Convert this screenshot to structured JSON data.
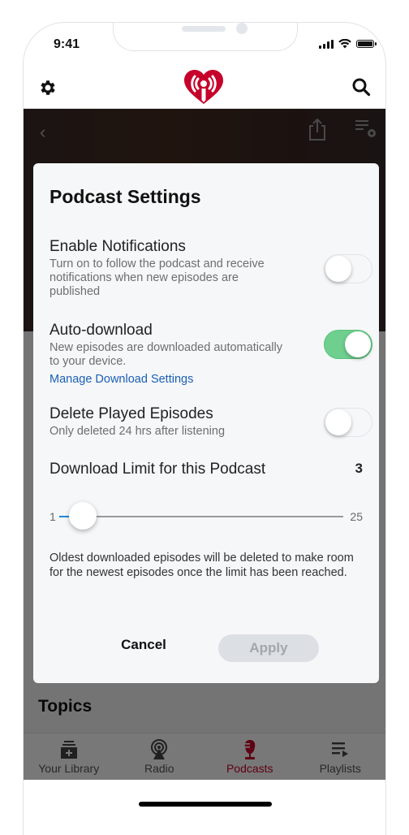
{
  "status_bar": {
    "time": "9:41"
  },
  "app_bar": {
    "logo": "iheartradio-logo",
    "left_icon": "gear-icon",
    "right_icon": "search-icon"
  },
  "hero": {
    "back_icon": "chevron-left-icon",
    "back_glyph": "‹",
    "share_icon": "share-icon",
    "queue_settings_icon": "queue-settings-icon"
  },
  "background": {
    "section_title": "Topics"
  },
  "tabs": [
    {
      "label": "Your Library",
      "icon": "library-add-icon",
      "active": false
    },
    {
      "label": "Radio",
      "icon": "radio-antenna-icon",
      "active": false
    },
    {
      "label": "Podcasts",
      "icon": "microphone-icon",
      "active": true
    },
    {
      "label": "Playlists",
      "icon": "playlist-icon",
      "active": false
    }
  ],
  "modal": {
    "title": "Podcast Settings",
    "notifications": {
      "title": "Enable Notifications",
      "description": "Turn on to follow the podcast and receive notifications when new episodes are published",
      "enabled": false
    },
    "auto_download": {
      "title": "Auto-download",
      "description": "New episodes are downloaded automatically to your device.",
      "link": "Manage Download Settings",
      "enabled": true
    },
    "delete_played": {
      "title": "Delete Played Episodes",
      "description": "Only deleted 24 hrs after listening",
      "enabled": false
    },
    "download_limit": {
      "label": "Download Limit for this Podcast",
      "value": "3",
      "min_label": "1",
      "max_label": "25",
      "min": 1,
      "max": 25,
      "current": 3
    },
    "note": "Oldest downloaded episodes will be deleted to make room for the newest episodes once the limit has been reached.",
    "cancel_label": "Cancel",
    "apply_label": "Apply"
  },
  "colors": {
    "brand_red": "#c6002b",
    "toggle_on": "#6fcf8e",
    "link": "#1a5fb4",
    "slider_fill": "#1e88d8"
  }
}
